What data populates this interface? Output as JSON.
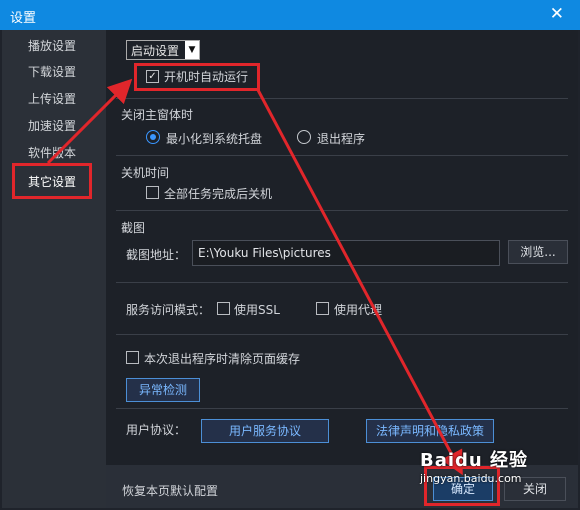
{
  "window": {
    "title": "设置"
  },
  "sidebar": {
    "items": [
      {
        "label": "播放设置"
      },
      {
        "label": "下载设置"
      },
      {
        "label": "上传设置"
      },
      {
        "label": "加速设置"
      },
      {
        "label": "软件版本"
      },
      {
        "label": "其它设置"
      }
    ]
  },
  "main": {
    "select_value": "启动设置",
    "startup_checkbox": "开机时自动运行",
    "close_section": {
      "title": "关闭主窗体时",
      "option1": "最小化到系统托盘",
      "option2": "退出程序"
    },
    "shutdown_section": {
      "title": "关机时间",
      "checkbox": "全部任务完成后关机"
    },
    "screenshot_section": {
      "title": "截图",
      "path_label": "截图地址：",
      "path_value": "E:\\Youku Files\\pictures",
      "browse": "浏览..."
    },
    "service": {
      "label": "服务访问模式：",
      "ssl": "使用SSL",
      "proxy": "使用代理"
    },
    "clear_cache": "本次退出程序时清除页面缓存",
    "diag_button": "异常检测",
    "agreement": {
      "label": "用户协议：",
      "service_btn": "用户服务协议",
      "legal_btn": "法律声明和隐私政策"
    }
  },
  "footer": {
    "restore": "恢复本页默认配置",
    "ok": "确定",
    "close": "关闭"
  },
  "watermark": {
    "text": "Baidu 经验",
    "url": "jingyan.baidu.com"
  }
}
